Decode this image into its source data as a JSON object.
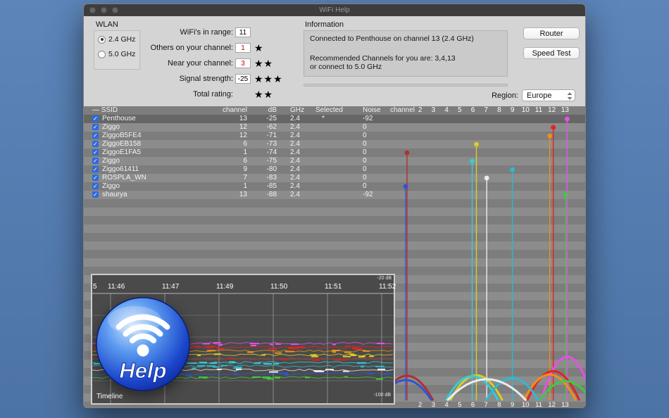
{
  "window": {
    "title": "WiFi Help"
  },
  "wlan": {
    "label": "WLAN",
    "options": [
      {
        "label": "2.4 GHz",
        "selected": true
      },
      {
        "label": "5.0 GHz",
        "selected": false
      }
    ]
  },
  "form": {
    "rows": [
      {
        "label": "WiFi's in range:",
        "value": "11",
        "value_color": "#000000",
        "stars": 0
      },
      {
        "label": "Others on your channel:",
        "value": "1",
        "value_color": "#cc0000",
        "stars": 1
      },
      {
        "label": "Near your channel:",
        "value": "3",
        "value_color": "#cc0000",
        "stars": 2
      },
      {
        "label": "Signal strength:",
        "value": "-25",
        "value_color": "#000000",
        "stars": 3
      },
      {
        "label": "Total rating:",
        "stars": 2
      }
    ]
  },
  "information": {
    "label": "Information",
    "line1": "Connected to Penthouse on channel 13 (2.4 GHz)",
    "line2": "Recommended Channels for you are: 3,4,13",
    "line3": " or connect to 5.0 GHz"
  },
  "buttons": {
    "router": "Router",
    "speed_test": "Speed Test"
  },
  "region": {
    "label": "Region:",
    "value": "Europe"
  },
  "table": {
    "headers": {
      "ssid": "— SSID",
      "channel": "channel",
      "db": "dB",
      "ghz": "GHz",
      "selected": "Selected",
      "noise": "Noise"
    }
  },
  "chart_data": {
    "type": "scatter",
    "title": "WiFi networks: signal strength (dB) per channel with coverage arcs",
    "x_axis": {
      "label": "channel",
      "ticks": [
        2,
        3,
        4,
        5,
        6,
        7,
        8,
        9,
        10,
        11,
        12,
        13
      ]
    },
    "y_unit": "dB",
    "networks": [
      {
        "checked": true,
        "row_selected": true,
        "ssid": "Penthouse",
        "channel": 13,
        "db": -25,
        "ghz": "2.4",
        "selected": "*",
        "noise": -92,
        "color": "#e94fe9",
        "xoff": 3
      },
      {
        "checked": true,
        "row_selected": false,
        "ssid": "Ziggo",
        "channel": 12,
        "db": -62,
        "ghz": "2.4",
        "selected": "",
        "noise": 0,
        "color": "#e52222",
        "xoff": 2
      },
      {
        "checked": true,
        "row_selected": false,
        "ssid": "ZiggoB5FE4",
        "channel": 12,
        "db": -71,
        "ghz": "2.4",
        "selected": "",
        "noise": 0,
        "color": "#ef8f1c",
        "xoff": -3
      },
      {
        "checked": true,
        "row_selected": false,
        "ssid": "ZiggoEB158",
        "channel": 6,
        "db": -73,
        "ghz": "2.4",
        "selected": "",
        "noise": 0,
        "color": "#d9cf24",
        "xoff": 5
      },
      {
        "checked": true,
        "row_selected": false,
        "ssid": "ZiggoE1FA5",
        "channel": 1,
        "db": -74,
        "ghz": "2.4",
        "selected": "",
        "noise": 0,
        "color": "#b03030",
        "xoff": 0
      },
      {
        "checked": true,
        "row_selected": false,
        "ssid": "Ziggo",
        "channel": 6,
        "db": -75,
        "ghz": "2.4",
        "selected": "",
        "noise": 0,
        "color": "#35cdd8",
        "xoff": -1
      },
      {
        "checked": true,
        "row_selected": false,
        "ssid": "Ziggo61411",
        "channel": 9,
        "db": -80,
        "ghz": "2.4",
        "selected": "",
        "noise": 0,
        "color": "#2fb9cf",
        "xoff": 0
      },
      {
        "checked": true,
        "row_selected": false,
        "ssid": "ROSPLA_WN",
        "channel": 7,
        "db": -83,
        "ghz": "2.4",
        "selected": "",
        "noise": 0,
        "color": "#ececec",
        "xoff": 1
      },
      {
        "checked": true,
        "row_selected": false,
        "ssid": "Ziggo",
        "channel": 1,
        "db": -85,
        "ghz": "2.4",
        "selected": "",
        "noise": 0,
        "color": "#2e55d4",
        "xoff": -2
      },
      {
        "checked": true,
        "row_selected": false,
        "ssid": "shaurya",
        "channel": 13,
        "db": -88,
        "ghz": "2.4",
        "selected": "",
        "noise": -92,
        "color": "#3ecb3e",
        "xoff": 1
      }
    ]
  },
  "timeline": {
    "title": "Timeline",
    "left_edge": "5",
    "times": [
      "11:46",
      "11:47",
      "11:49",
      "11:50",
      "11:51",
      "11:52"
    ],
    "top_db": "-20 dB",
    "bottom_db": "-100 dB"
  },
  "logo": {
    "text": "Help"
  }
}
